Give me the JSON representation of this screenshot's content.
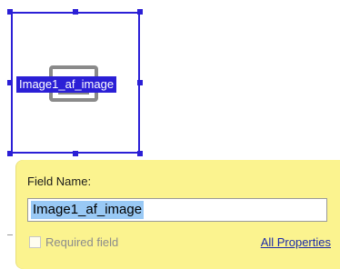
{
  "field": {
    "label": "Image1_af_image",
    "selection_color": "#2b1fd6"
  },
  "popup": {
    "title": "Field Name:",
    "name_value": "Image1_af_image",
    "required_label": "Required field",
    "required_checked": false,
    "all_properties_label": "All Properties",
    "background_color": "#fbf38f"
  },
  "icons": {
    "image": "image-placeholder-icon"
  }
}
